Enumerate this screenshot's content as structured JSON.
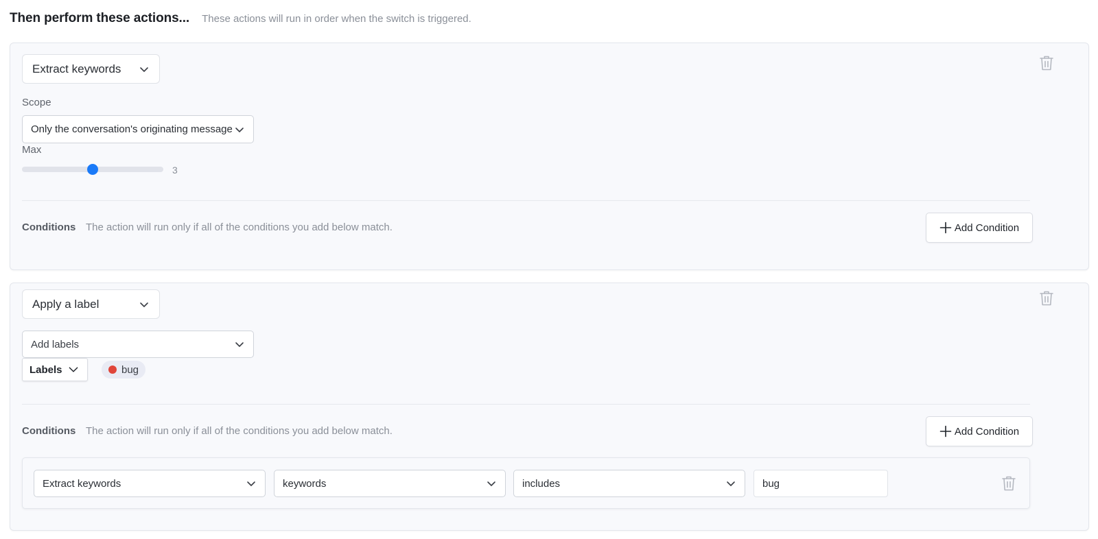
{
  "header": {
    "title": "Then perform these actions...",
    "subtitle": "These actions will run in order when the switch is triggered."
  },
  "colors": {
    "accent": "#1a7af8",
    "label_bug": "#e0453a"
  },
  "actions": [
    {
      "type_selected": "Extract keywords",
      "scope_label": "Scope",
      "scope_selected": "Only the conversation's originating message",
      "max_label": "Max",
      "max_value": "3",
      "max_slider_fraction": 0.5,
      "conditions_title": "Conditions",
      "conditions_desc": "The action will run only if all of the conditions you add below match.",
      "add_condition_label": "Add Condition"
    },
    {
      "type_selected": "Apply a label",
      "labels_placeholder": "Add labels",
      "labels_toggle": "Labels",
      "applied_labels": [
        {
          "name": "bug",
          "color": "#e0453a"
        }
      ],
      "conditions_title": "Conditions",
      "conditions_desc": "The action will run only if all of the conditions you add below match.",
      "add_condition_label": "Add Condition",
      "conditions": [
        {
          "source": "Extract keywords",
          "field": "keywords",
          "operator": "includes",
          "value": "bug"
        }
      ]
    }
  ],
  "icons": {
    "delete": "trash-icon",
    "dropdown": "chevron-down-icon",
    "add": "plus-icon"
  }
}
